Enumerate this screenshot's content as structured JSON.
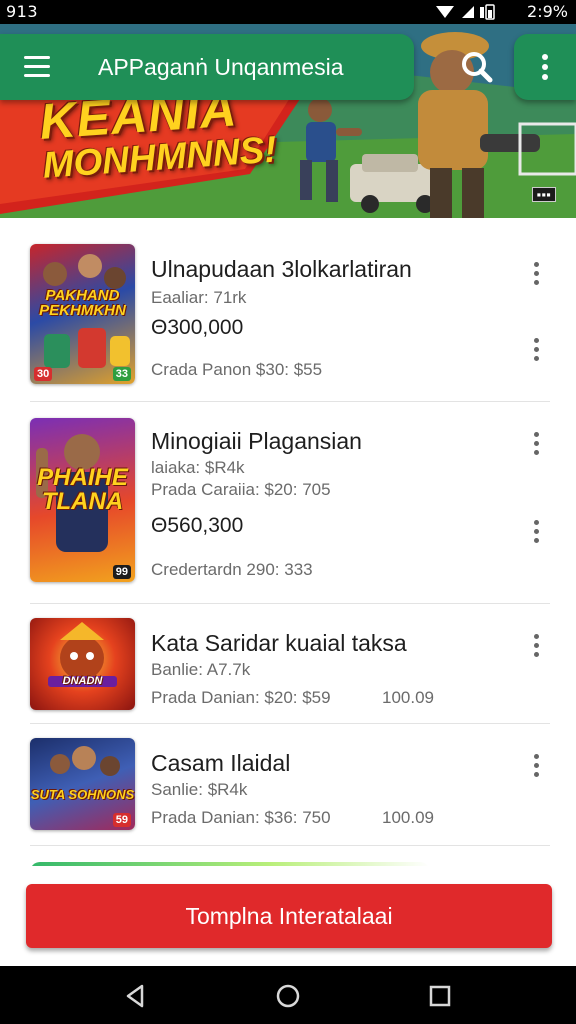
{
  "status_bar": {
    "time_left": "913",
    "time_right": "2:9%"
  },
  "app_bar": {
    "title": "APPaganṅ Unqanmesia"
  },
  "banner": {
    "title_line1": "KEANIA",
    "title_line2": "MONHMNNS!"
  },
  "games": [
    {
      "thumb_title": "PAKHAND PEKHMKHN",
      "badge_left": "30",
      "badge_right": "33",
      "title": "Ulnapudaan 3lolkarlatiran",
      "meta1": "Eaaliar: 71rk",
      "price": "Θ300,000",
      "meta2": "Crada Panon  $30:  $55",
      "meta2_extra": ""
    },
    {
      "thumb_title": "PHAIHE TLANA",
      "badge_left": "",
      "badge_right": "99",
      "title": "Minogiaii Plagansian",
      "meta1": "laiaka: $R4k",
      "meta1b": "Prada Caraiia:  $20:  705",
      "price": "Θ560,300",
      "meta2": "Credertardn   290:  333",
      "meta2_extra": ""
    },
    {
      "thumb_title": "DNADN",
      "badge_left": "",
      "badge_right": "",
      "title": "Kata Saridar kuaial  taksa",
      "meta1": "Banlie: A7.7k",
      "meta2": "Prada Danian:  $20:  $59",
      "meta2_extra": "100.09"
    },
    {
      "thumb_title": "SUTA SOHNONS",
      "badge_left": "",
      "badge_right": "59",
      "title": "Casam Ilaidal",
      "meta1": "Sanlie: $R4k",
      "meta2": "Prada Danian:  $36:  750",
      "meta2_extra": "100.09"
    }
  ],
  "cta": {
    "label": "Tomplna Interatalaai"
  },
  "colors": {
    "appbar": "#1f8f57",
    "cta": "#e0292b"
  },
  "icons": [
    "menu-icon",
    "search-icon",
    "more-vert-icon",
    "back-icon",
    "home-icon",
    "recents-icon"
  ]
}
